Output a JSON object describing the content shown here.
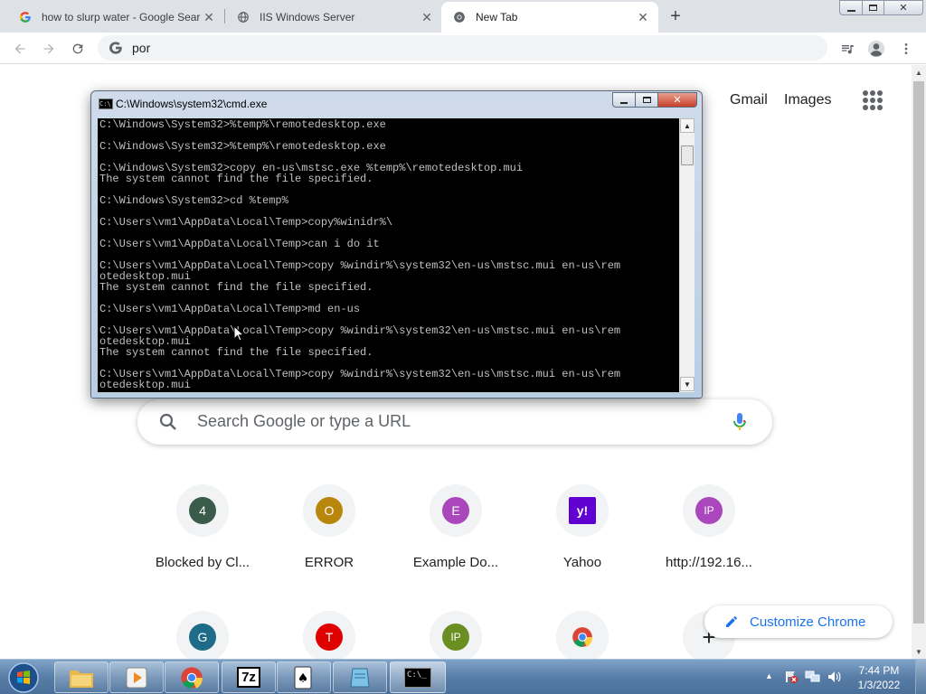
{
  "browser": {
    "tabs": [
      {
        "title": "how to slurp water - Google Search",
        "favicon": "google-g-icon"
      },
      {
        "title": "IIS Windows Server",
        "favicon": "globe-icon"
      },
      {
        "title": "New Tab",
        "favicon": "chrome-icon"
      }
    ],
    "new_tab_symbol": "+",
    "omnibox_value": "por"
  },
  "ntp": {
    "header_links": [
      "Gmail",
      "Images"
    ],
    "search_placeholder": "Search Google or type a URL",
    "shortcuts": [
      {
        "letter": "4",
        "label": "Blocked by Cl...",
        "color": "#3a5a4a"
      },
      {
        "letter": "O",
        "label": "ERROR",
        "color": "#b8860b"
      },
      {
        "letter": "E",
        "label": "Example Do...",
        "color": "#ab47bc"
      },
      {
        "letter": "y!",
        "label": "Yahoo",
        "color": "#6001d2"
      },
      {
        "letter": "IP",
        "label": "http://192.16...",
        "color": "#ab47bc"
      },
      {
        "letter": "G",
        "label": "",
        "color": "#1e6b8a"
      },
      {
        "letter": "T",
        "label": "",
        "color": "#e00000"
      },
      {
        "letter": "IP",
        "label": "",
        "color": "#6b8e23"
      },
      {
        "letter": "",
        "label": "",
        "color": "#ffffff"
      },
      {
        "letter": "+",
        "label": "",
        "color": "#ffffff"
      }
    ],
    "customize_label": "Customize Chrome"
  },
  "cmd": {
    "title": "C:\\Windows\\system32\\cmd.exe",
    "lines": [
      "C:\\Windows\\System32>%temp%\\remotedesktop.exe",
      "",
      "C:\\Windows\\System32>%temp%\\remotedesktop.exe",
      "",
      "C:\\Windows\\System32>copy en-us\\mstsc.exe %temp%\\remotedesktop.mui",
      "The system cannot find the file specified.",
      "",
      "C:\\Windows\\System32>cd %temp%",
      "",
      "C:\\Users\\vm1\\AppData\\Local\\Temp>copy%winidr%\\",
      "",
      "C:\\Users\\vm1\\AppData\\Local\\Temp>can i do it",
      "",
      "C:\\Users\\vm1\\AppData\\Local\\Temp>copy %windir%\\system32\\en-us\\mstsc.mui en-us\\rem",
      "otedesktop.mui",
      "The system cannot find the file specified.",
      "",
      "C:\\Users\\vm1\\AppData\\Local\\Temp>md en-us",
      "",
      "C:\\Users\\vm1\\AppData\\Local\\Temp>copy %windir%\\system32\\en-us\\mstsc.mui en-us\\rem",
      "otedesktop.mui",
      "The system cannot find the file specified.",
      "",
      "C:\\Users\\vm1\\AppData\\Local\\Temp>copy %windir%\\system32\\en-us\\mstsc.mui en-us\\rem",
      "otedesktop.mui"
    ]
  },
  "taskbar": {
    "items": [
      {
        "name": "explorer",
        "icon": "folder-icon"
      },
      {
        "name": "media-player",
        "icon": "media-player-icon"
      },
      {
        "name": "chrome",
        "icon": "chrome-icon"
      },
      {
        "name": "7zip",
        "icon": "7zip-icon",
        "text": "7z"
      },
      {
        "name": "solitaire",
        "icon": "solitaire-icon"
      },
      {
        "name": "notepad",
        "icon": "notepad-icon"
      },
      {
        "name": "cmd",
        "icon": "cmd-icon",
        "text": "C:\\_"
      }
    ],
    "time": "7:44 PM",
    "date": "1/3/2022"
  }
}
